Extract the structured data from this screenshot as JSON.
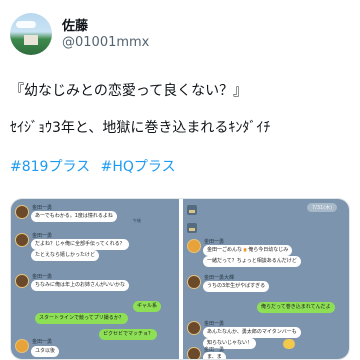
{
  "profile": {
    "name": "佐藤",
    "handle": "@01001mmx"
  },
  "tweet": {
    "line1": "『幼なじみとの恋愛って良くない？』",
    "line2": "ｾｲｼﾞｮｳ3年と、地獄に巻き込まれるｷﾝﾀﾞｲﾁ",
    "hashtags": [
      "#819プラス",
      "#HQプラス"
    ]
  },
  "chat_left": {
    "messages": [
      {
        "sender": "金田一勇",
        "text": "あーでもわかる。1度は憧れるよね",
        "time": "午後",
        "side": "left"
      },
      {
        "sender": "金田一勇",
        "text": "だよね？じゃ俺に全部手伝ってくれる？",
        "time": "",
        "side": "left"
      },
      {
        "sender": "",
        "text": "たとえなら嬉しかったけど",
        "time": "",
        "side": "left"
      },
      {
        "sender": "金田一勇",
        "text": "ちなみに俺は年上のお姉さんがいいかな",
        "time": "",
        "side": "left"
      },
      {
        "sender": "",
        "text": "ギャル系",
        "time": "",
        "side": "right"
      },
      {
        "sender": "",
        "text": "スタートラインで競ってプリ撮るか？",
        "time": "",
        "side": "right"
      },
      {
        "sender": "",
        "text": "ピクセビでマッチョ？",
        "time": "",
        "side": "right"
      },
      {
        "sender": "金田一勇",
        "text": "ユタ以後",
        "time": "",
        "side": "left"
      }
    ]
  },
  "chat_right": {
    "date_pill": "7/31(木)",
    "messages": [
      {
        "sender": "金田一勇",
        "text": "金田一ごめんな🍺俺ら今日幼なじみ",
        "time": "",
        "side": "left"
      },
      {
        "sender": "",
        "text": "一緒だって？ちょっと相談あるんだけど",
        "time": "",
        "side": "left"
      },
      {
        "sender": "金田一勇大輝",
        "text": "うちの3年生がやばすぎる",
        "time": "",
        "side": "left"
      },
      {
        "sender": "",
        "text": "俺らだって巻き込まれてんだよ",
        "time": "",
        "side": "right"
      },
      {
        "sender": "金田一勇",
        "text": "あんたなんか、勇太郎のマイタンバーも",
        "time": "",
        "side": "left"
      },
      {
        "sender": "",
        "text": "知らないじゃない！",
        "time": "",
        "side": "left"
      },
      {
        "sender": "金田一勇",
        "text": "ま、ま",
        "time": "",
        "side": "left"
      }
    ]
  },
  "colors": {
    "chat_bg": "#7c94ad",
    "bubble_mine": "#8de055",
    "hashtag": "#1d9bf0"
  }
}
